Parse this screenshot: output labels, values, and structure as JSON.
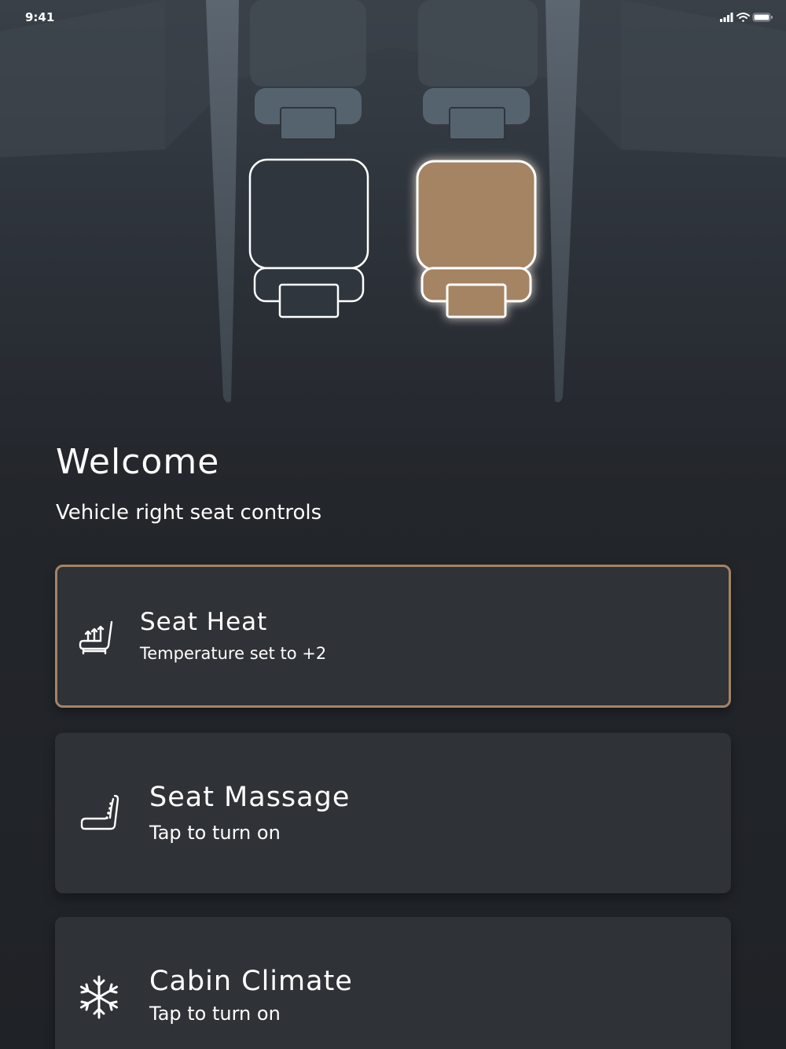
{
  "status_bar": {
    "time": "9:41",
    "icons": [
      "cellular-signal-icon",
      "wifi-icon",
      "battery-icon"
    ]
  },
  "hero": {
    "seats": [
      {
        "name": "left-seat",
        "selected": false
      },
      {
        "name": "right-seat",
        "selected": true
      }
    ],
    "colors": {
      "selected_seat": "#a58463",
      "seat_outline": "#ffffff"
    }
  },
  "header": {
    "title": "Welcome",
    "subtitle": "Vehicle right seat controls"
  },
  "cards": [
    {
      "icon": "seat-heat-icon",
      "title": "Seat Heat",
      "status": "Temperature set to +2",
      "selected": true
    },
    {
      "icon": "seat-massage-icon",
      "title": "Seat Massage",
      "status": "Tap to turn on",
      "selected": false
    },
    {
      "icon": "snowflake-icon",
      "title": "Cabin Climate",
      "status": "Tap to turn on",
      "selected": false
    }
  ],
  "colors": {
    "accent": "#a58463",
    "card_background": "#2f3237",
    "page_background": "#22252a"
  }
}
